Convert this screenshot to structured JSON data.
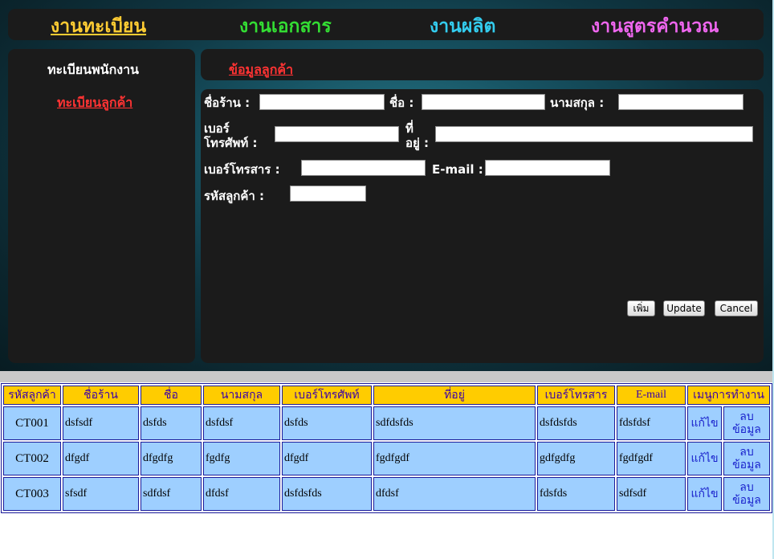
{
  "nav": {
    "items": [
      "งานทะเบียน",
      "งานเอกสาร",
      "งานผลิต",
      "งานสูตรคำนวณ"
    ]
  },
  "sidebar": {
    "title": "ทะเบียนพนักงาน",
    "link": "ทะเบียนลูกค้า"
  },
  "header": {
    "title": "ข้อมูลลูกค้า"
  },
  "form": {
    "shop_name_label": "ชื่อร้าน :",
    "name_label": "ชื่อ :",
    "surname_label": "นามสกุล :",
    "phone_label_line1": "เบอร์",
    "phone_label_line2": "โทรศัพท์ :",
    "address_label_line1": "ที่",
    "address_label_line2": "อยู่ :",
    "fax_label": "เบอร์โทรสาร :",
    "email_label": "E-mail :",
    "customer_id_label": "รหัสลูกค้า :",
    "shop_name_value": "",
    "name_value": "",
    "surname_value": "",
    "phone_value": "",
    "address_value": "",
    "fax_value": "",
    "email_value": "",
    "customer_id_value": ""
  },
  "buttons": {
    "add": "เพิ่ม",
    "update": "Update",
    "cancel": "Cancel"
  },
  "table": {
    "headers": [
      "รหัสลูกค้า",
      "ชื่อร้าน",
      "ชื่อ",
      "นามสกุล",
      "เบอร์โทรศัพท์",
      "ที่อยู่",
      "เบอร์โทรสาร",
      "E-mail",
      "เมนูการทำงาน"
    ],
    "rows": [
      {
        "code": "CT001",
        "shop": "dsfsdf",
        "name": "dsfds",
        "surname": "dsfdsf",
        "phone": "dsfds",
        "address": "sdfdsfds",
        "fax": "dsfdsfds",
        "email": "fdsfdsf",
        "edit": "แก้ไข",
        "delete_line1": "ลบ",
        "delete_line2": "ข้อมูล"
      },
      {
        "code": "CT002",
        "shop": "dfgdf",
        "name": "dfgdfg",
        "surname": "fgdfg",
        "phone": "dfgdf",
        "address": "fgdfgdf",
        "fax": "gdfgdfg",
        "email": "fgdfgdf",
        "edit": "แก้ไข",
        "delete_line1": "ลบ",
        "delete_line2": "ข้อมูล"
      },
      {
        "code": "CT003",
        "shop": "sfsdf",
        "name": "sdfdsf",
        "surname": "dfdsf",
        "phone": "dsfdsfds",
        "address": "dfdsf",
        "fax": "fdsfds",
        "email": "sdfsdf",
        "edit": "แก้ไข",
        "delete_line1": "ลบ",
        "delete_line2": "ข้อมูล"
      }
    ]
  },
  "colors": {
    "nav_registration": "#ffcc33",
    "nav_documents": "#33dd33",
    "nav_production": "#33ccee",
    "nav_formula": "#ee66ee",
    "link_red": "#ff3333",
    "table_header_bg": "#ffcc00",
    "table_cell_bg": "#9ecfff"
  }
}
